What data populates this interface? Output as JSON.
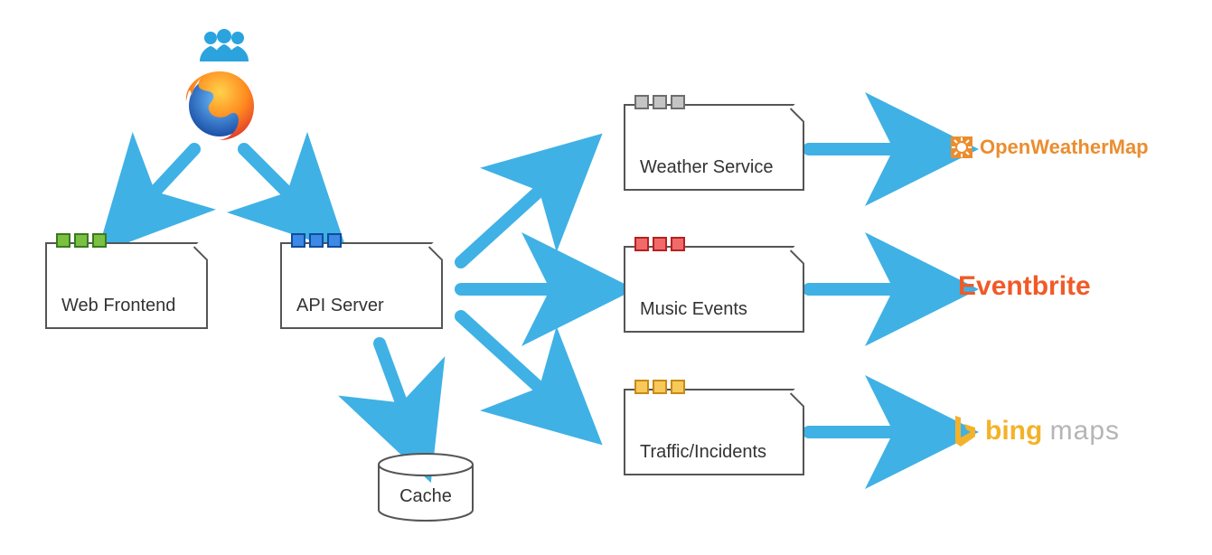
{
  "users_icon": "users-icon",
  "browser_icon": "firefox-icon",
  "nodes": {
    "web_frontend": {
      "label": "Web Frontend",
      "tab_color": "#55a630"
    },
    "api_server": {
      "label": "API Server",
      "tab_color": "#1f78d1"
    },
    "weather": {
      "label": "Weather Service",
      "tab_color": "#9c9c9c"
    },
    "music": {
      "label": "Music Events",
      "tab_color": "#e84a4a"
    },
    "traffic": {
      "label": "Traffic/Incidents",
      "tab_color": "#f2b233"
    },
    "cache": {
      "label": "Cache"
    }
  },
  "external": {
    "owm": {
      "label": "OpenWeatherMap"
    },
    "eb": {
      "label": "Eventbrite"
    },
    "bing": {
      "logo_text": "b",
      "brand": "bing",
      "suffix": "maps"
    }
  },
  "arrows": {
    "color": "#3fb1e5",
    "edges": [
      "browser->web_frontend",
      "browser->api_server",
      "api_server->weather",
      "api_server->music",
      "api_server->traffic",
      "api_server->cache",
      "weather->owm",
      "music->eb",
      "traffic->bing"
    ]
  }
}
